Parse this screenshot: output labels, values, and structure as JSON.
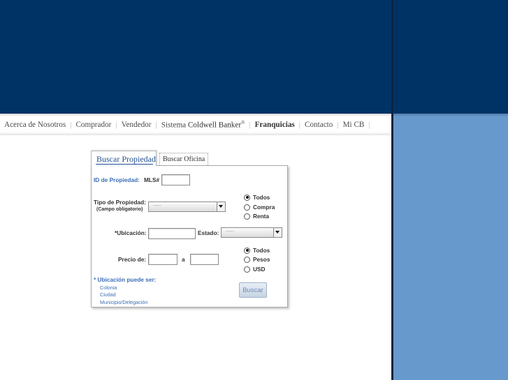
{
  "colors": {
    "banner": "#003365",
    "right_panel": "#6799cc",
    "link_blue": "#3c6fb7"
  },
  "nav": {
    "items": [
      {
        "label": "Acerca de Nosotros",
        "bold": false
      },
      {
        "label": "Comprador",
        "bold": false
      },
      {
        "label": "Vendedor",
        "bold": false
      },
      {
        "label": "Sistema ",
        "bold": false,
        "suffix_bold": "Coldwell Banker",
        "sup": "®"
      },
      {
        "label": "Franquicias",
        "bold": true
      },
      {
        "label": "Contacto",
        "bold": false
      },
      {
        "label": "Mi CB",
        "bold": false
      }
    ]
  },
  "tabs": {
    "active": "Buscar Propiedad",
    "inactive": "Buscar Oficina"
  },
  "form": {
    "id_label": "ID de Propiedad:",
    "mls_label": "MLS#",
    "mls_value": "",
    "tipo_label": "Tipo de Propiedad:",
    "tipo_note": "(Campo obligatorio)",
    "tipo_value": "-----",
    "operation_options": [
      {
        "label": "Todos",
        "selected": true
      },
      {
        "label": "Compra",
        "selected": false
      },
      {
        "label": "Renta",
        "selected": false
      }
    ],
    "ubicacion_label": "*Ubicación:",
    "ubicacion_value": "",
    "estado_label": "Estado:",
    "estado_value": "-----",
    "precio_label": "Precio de:",
    "precio_from": "",
    "precio_a": "a",
    "precio_to": "",
    "currency_options": [
      {
        "label": "Todos",
        "selected": true
      },
      {
        "label": "Pesos",
        "selected": false
      },
      {
        "label": "USD",
        "selected": false
      }
    ],
    "note_title": "* Ubicación puede ser:",
    "note_items": [
      "Colonia",
      "Ciudad",
      "Municipio/Delegación"
    ],
    "submit_label": "Buscar"
  }
}
